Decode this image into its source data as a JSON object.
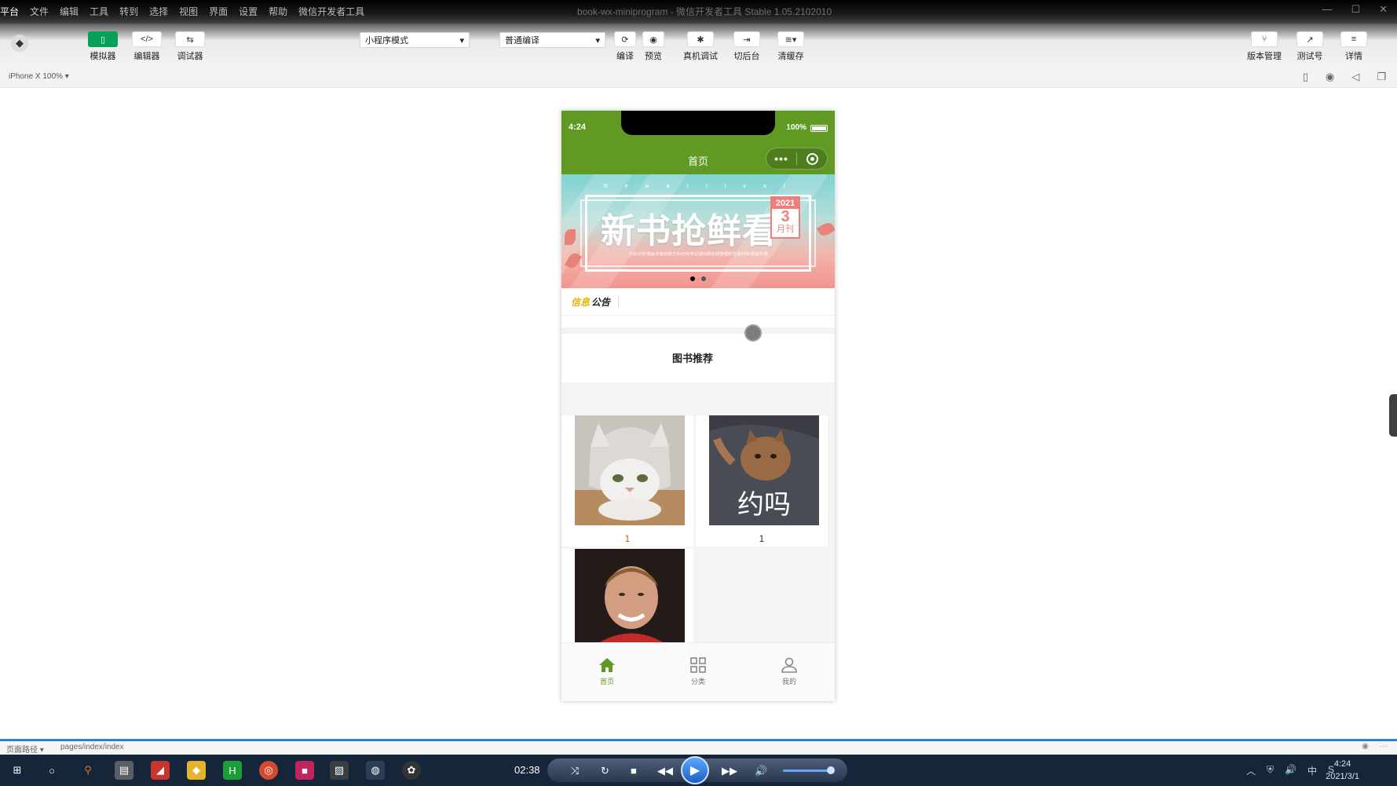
{
  "titlebar": {
    "menus": [
      "平台",
      "文件",
      "编辑",
      "工具",
      "转到",
      "选择",
      "视图",
      "界面",
      "设置",
      "帮助",
      "微信开发者工具"
    ],
    "window_title": "book-wx-miniprogram - 微信开发者工具 Stable 1.05.2102010",
    "minimize": "—",
    "maximize": "☐",
    "close": "✕"
  },
  "toolbar": {
    "simulator_label": "模拟器",
    "editor_label": "编辑器",
    "debugger_label": "调试器",
    "mode_select": "小程序模式",
    "compile_select": "普通编译",
    "compile_label": "编译",
    "preview_label": "预览",
    "remote_debug_label": "真机调试",
    "background_label": "切后台",
    "clear_cache_label": "清缓存",
    "version_label": "版本管理",
    "test_label": "测试号",
    "details_label": "详情",
    "editor_glyph": "</>",
    "debugger_glyph": "⇆"
  },
  "devicebar": {
    "device": "iPhone X 100% ▾"
  },
  "phone": {
    "time": "4:24",
    "battery": "100%",
    "nav_title": "首页",
    "capsule_more": "•••",
    "banner": {
      "subtitle": "N e w   a r r i v a l",
      "headline": "新书抢鲜看",
      "year": "2021",
      "number": "3",
      "month": "月刊",
      "categories": "小说/文学/漫画/青春动漫/艺术/社科/传记/成功励志/经管理财/生活/科技/考试/外语"
    },
    "notice_part1": "信息",
    "notice_part2": "公告",
    "section_title": "图书推荐",
    "books": [
      {
        "caption": "1"
      },
      {
        "caption": "1"
      },
      {
        "caption": ""
      }
    ],
    "tabs": [
      {
        "label": "首页"
      },
      {
        "label": "分类"
      },
      {
        "label": "我的"
      }
    ]
  },
  "pathbar": {
    "label": "页面路径 ▾",
    "path": "pages/index/index",
    "eye": "◉",
    "more": "···"
  },
  "media_player": {
    "time": "02:38"
  },
  "clock": {
    "time": "4:24",
    "date": "2021/3/1"
  },
  "tray": [
    "︿",
    "⛨",
    "🔊",
    "中",
    "S"
  ],
  "colors": {
    "nav_green": "#609a23",
    "accent_green": "#07a05a",
    "notice_yellow": "#e8b30b"
  }
}
